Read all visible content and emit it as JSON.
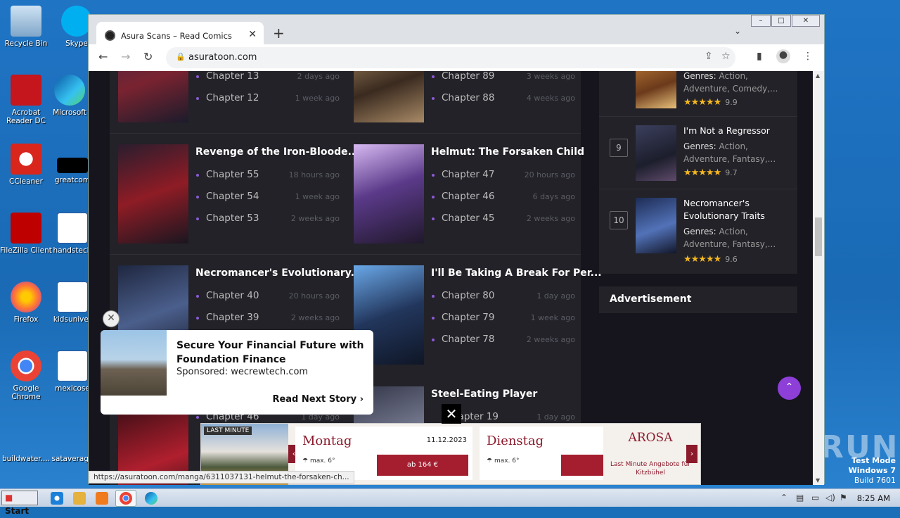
{
  "desktop": {
    "icons": [
      {
        "label": "Recycle Bin",
        "icon": "recycle-bin-icon"
      },
      {
        "label": "Skype",
        "icon": "skype-icon"
      },
      {
        "label": "Acrobat Reader DC",
        "icon": "acrobat-icon"
      },
      {
        "label": "Microsoft",
        "icon": "edge-icon"
      },
      {
        "label": "CCleaner",
        "icon": "ccleaner-icon"
      },
      {
        "label": "greatcom",
        "icon": "file-icon"
      },
      {
        "label": "FileZilla Client",
        "icon": "filezilla-icon"
      },
      {
        "label": "handstech",
        "icon": "word-doc-icon"
      },
      {
        "label": "Firefox",
        "icon": "firefox-icon"
      },
      {
        "label": "kidsuniver",
        "icon": "word-doc-icon"
      },
      {
        "label": "Google Chrome",
        "icon": "chrome-icon"
      },
      {
        "label": "mexicose",
        "icon": "word-doc-icon"
      },
      {
        "label": "buildwater....",
        "icon": "file-icon"
      },
      {
        "label": "sataverage",
        "icon": "file-icon"
      }
    ],
    "watermark": "ANY RUN",
    "test_mode": {
      "line1": "Test Mode",
      "line2": "Windows 7",
      "line3": "Build 7601"
    }
  },
  "browser": {
    "tab_title": "Asura Scans – Read Comics",
    "url": "asuratoon.com",
    "status_url": "https://asuratoon.com/manga/6311037131-helmut-the-forsaken-ch..."
  },
  "latest": [
    {
      "title": "",
      "chapters": [
        {
          "label": "Chapter 13",
          "ago": "2 days ago"
        },
        {
          "label": "Chapter 12",
          "ago": "1 week ago"
        }
      ]
    },
    {
      "title": "",
      "chapters": [
        {
          "label": "Chapter 89",
          "ago": "3 weeks ago"
        },
        {
          "label": "Chapter 88",
          "ago": "4 weeks ago"
        }
      ]
    },
    {
      "title": "Revenge of the Iron-Bloode...",
      "chapters": [
        {
          "label": "Chapter 55",
          "ago": "18 hours ago"
        },
        {
          "label": "Chapter 54",
          "ago": "1 week ago"
        },
        {
          "label": "Chapter 53",
          "ago": "2 weeks ago"
        }
      ]
    },
    {
      "title": "Helmut: The Forsaken Child",
      "chapters": [
        {
          "label": "Chapter 47",
          "ago": "20 hours ago"
        },
        {
          "label": "Chapter 46",
          "ago": "6 days ago"
        },
        {
          "label": "Chapter 45",
          "ago": "2 weeks ago"
        }
      ]
    },
    {
      "title": "Necromancer's Evolutionary...",
      "chapters": [
        {
          "label": "Chapter 40",
          "ago": "20 hours ago"
        },
        {
          "label": "Chapter 39",
          "ago": "2 weeks ago"
        },
        {
          "label": "Chapter 46",
          "ago": "1 day ago"
        }
      ]
    },
    {
      "title": "I'll Be Taking A Break For Per...",
      "chapters": [
        {
          "label": "Chapter 80",
          "ago": "1 day ago"
        },
        {
          "label": "Chapter 79",
          "ago": "1 week ago"
        },
        {
          "label": "Chapter 78",
          "ago": "2 weeks ago"
        }
      ]
    },
    {
      "title": "Steel-Eating Player",
      "chapters": [
        {
          "label": "hapter 19",
          "ago": "1 day ago"
        }
      ]
    }
  ],
  "popular": [
    {
      "rank": "",
      "title": "",
      "genres_label": "Genres:",
      "genres": "Action, Adventure, Comedy,...",
      "rating": "9.9",
      "stars": 5
    },
    {
      "rank": "9",
      "title": "I'm Not a Regressor",
      "genres_label": "Genres:",
      "genres": "Action, Adventure, Fantasy,...",
      "rating": "9.7",
      "stars": 5
    },
    {
      "rank": "10",
      "title": "Necromancer's Evolutionary Traits",
      "genres_label": "Genres:",
      "genres": "Action, Adventure, Fantasy,...",
      "rating": "9.6",
      "stars": 5
    }
  ],
  "advertisement_heading": "Advertisement",
  "sponsored": {
    "title": "Secure Your Financial Future with Foundation Finance",
    "sponsor": "Sponsored: wecrewtech.com",
    "read_next": "Read Next Story"
  },
  "banner_ad": {
    "tag": "LAST MINUTE",
    "day1": {
      "name": "Montag",
      "date": "11.12.2023",
      "price": "ab 164 €",
      "temp": "max. 6°"
    },
    "day2": {
      "name": "Dienstag",
      "temp": "max. 6°"
    },
    "brand": "AROSA",
    "text": "Last Minute Angebote für Kitzbühel"
  },
  "taskbar": {
    "start": "Start",
    "time": "8:25 AM"
  }
}
